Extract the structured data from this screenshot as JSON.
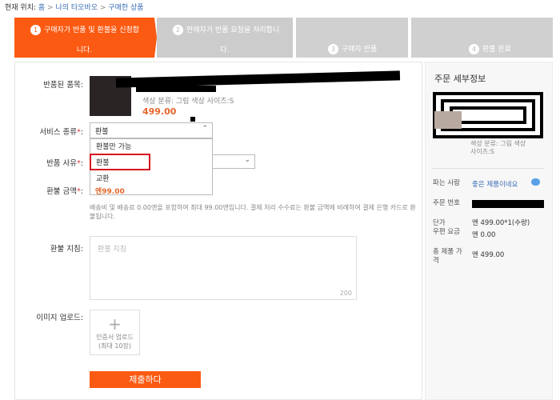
{
  "breadcrumb": {
    "prefix": "현재 위치:",
    "home": "홈",
    "my_taobao": "나의 타오바오",
    "purchased": "구매한 상품",
    "sep": ">"
  },
  "steps": [
    {
      "num": "1",
      "label": "구매자가 반품 및 환불을 신청합",
      "label2": "니다."
    },
    {
      "num": "2",
      "label": "판매자가 반품 요청을 처리합니",
      "label2": "다."
    },
    {
      "num": "3",
      "label": "구매자 반품"
    },
    {
      "num": "4",
      "label": "환불 완료"
    }
  ],
  "form": {
    "returned_item_label": "반품된 품목:",
    "item_meta": "색상 분류: 그림 색상   사이즈:S",
    "item_price": "499.00",
    "service_type_label": "서비스 종류",
    "service_type_value": "환불",
    "service_type_options": [
      "환불만 가능",
      "환불",
      "교환"
    ],
    "return_reason_label": "반품 사유",
    "refund_amount_label": "환불 금액",
    "refund_amount_value": "엔99.00",
    "refund_note": "배송비 및 배송료 0.00엔을 포함하여 최대 99.00엔입니다. 결제 처리 수수료는 환불 금액에 비례하여 결제 은행 카드로 환불됩니다.",
    "instructions_label": "환불 지침",
    "instructions_placeholder": "환불 지침",
    "char_count": "200",
    "image_upload_label": "이미지 업로드",
    "upload_text_1": "인증서 업로드",
    "upload_text_2": "(최대 10장)",
    "submit_label": "제출하다",
    "required_mark": "*",
    "colon": ":"
  },
  "order_details": {
    "title": "주문 세부정보",
    "item_meta_1": "색상 분류: 그림 색상",
    "item_meta_2": "사이즈:S",
    "seller_label": "파는 사람",
    "seller_value": "좋은 제품이네요",
    "order_no_label": "주문 번호",
    "unit_price_label": "단가",
    "unit_price_value": "엔 499.00*1(수량)",
    "shipping_label": "우편 요금",
    "shipping_value": "엔 0.00",
    "total_label": "총 제품 가격",
    "total_value": "엔 499.00"
  },
  "colors": {
    "accent": "#fb5a12",
    "link": "#3a6fb7",
    "highlight": "#d9161d"
  }
}
